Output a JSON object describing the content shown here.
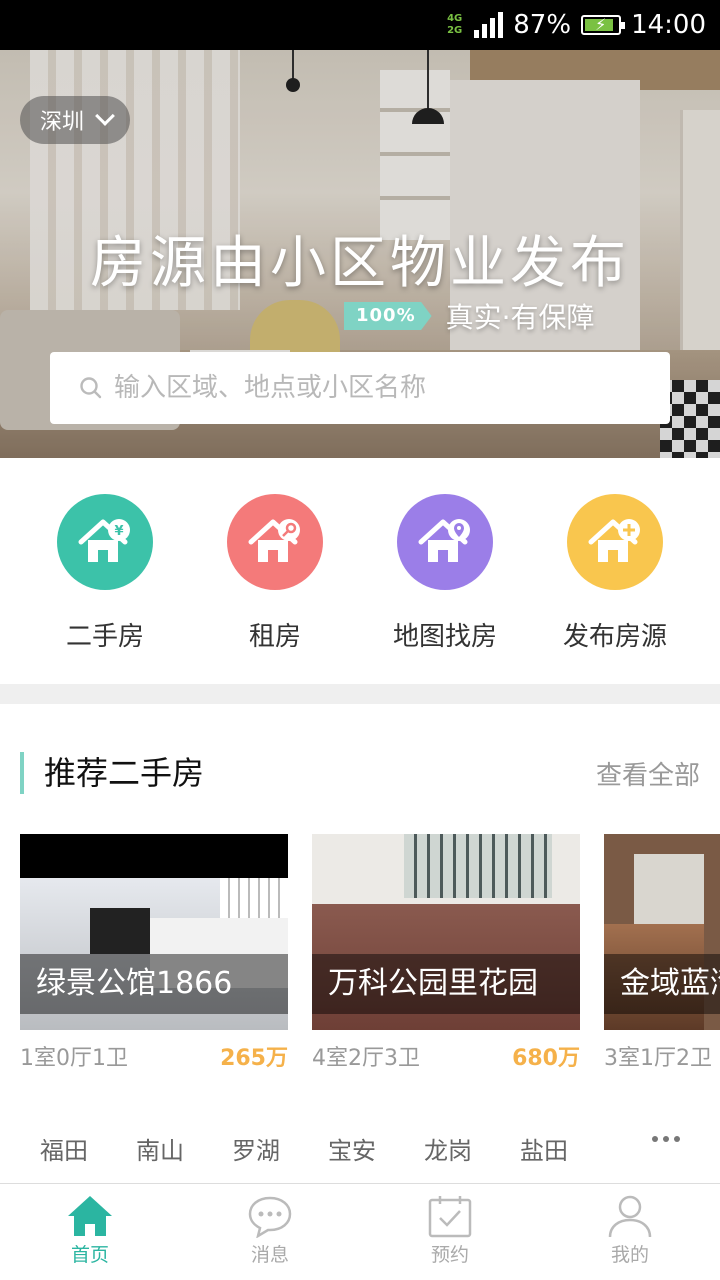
{
  "status_bar": {
    "network_top": "4G",
    "network_bottom": "2G",
    "battery_percent": "87%",
    "time": "14:00"
  },
  "hero": {
    "city": "深圳",
    "title": "房源由小区物业发布",
    "badge": "100%",
    "subtitle": "真实·有保障",
    "search_placeholder": "输入区域、地点或小区名称"
  },
  "categories": [
    {
      "label": "二手房",
      "icon": "house-yen-icon",
      "color": "#3cc2a9"
    },
    {
      "label": "租房",
      "icon": "house-key-icon",
      "color": "#f47a7a"
    },
    {
      "label": "地图找房",
      "icon": "house-location-icon",
      "color": "#9b7ee8"
    },
    {
      "label": "发布房源",
      "icon": "house-plus-icon",
      "color": "#f9c64e"
    }
  ],
  "recommend": {
    "title": "推荐二手房",
    "more": "查看全部",
    "listings": [
      {
        "name": "绿景公馆1866",
        "layout": "1室0厅1卫",
        "price": "265万"
      },
      {
        "name": "万科公园里花园",
        "layout": "4室2厅3卫",
        "price": "680万"
      },
      {
        "name": "金域蓝湾",
        "layout": "3室1厅2卫",
        "price": ""
      }
    ]
  },
  "districts": [
    "福田",
    "南山",
    "罗湖",
    "宝安",
    "龙岗",
    "盐田"
  ],
  "tabs": [
    {
      "label": "首页",
      "icon": "home-icon",
      "active": true
    },
    {
      "label": "消息",
      "icon": "message-icon",
      "active": false
    },
    {
      "label": "预约",
      "icon": "calendar-check-icon",
      "active": false
    },
    {
      "label": "我的",
      "icon": "user-icon",
      "active": false
    }
  ],
  "colors": {
    "accent": "#2bb5a1",
    "price": "#f5b14a",
    "section_bar": "#7fd3c4"
  }
}
